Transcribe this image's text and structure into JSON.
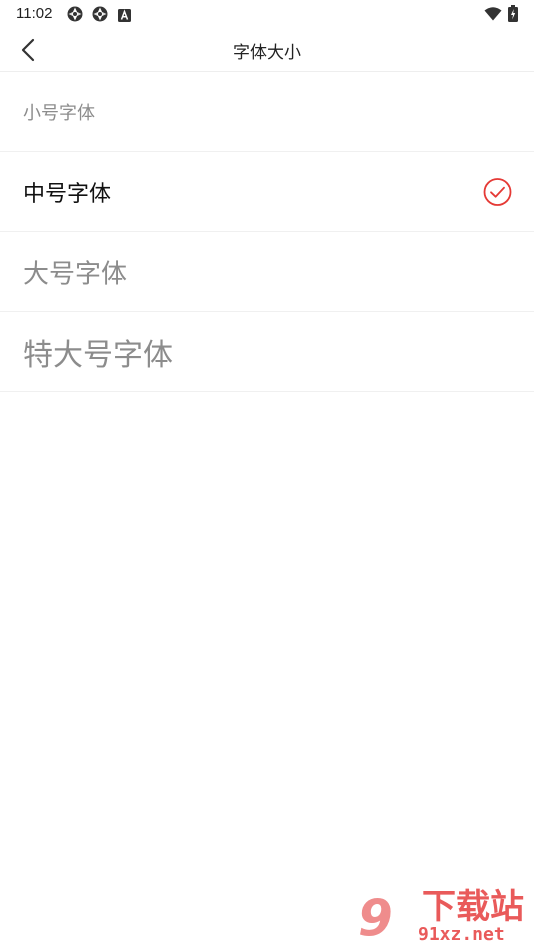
{
  "status_bar": {
    "time": "11:02",
    "icons": [
      "aperture-icon",
      "aperture-icon",
      "font-a-icon",
      "wifi-icon",
      "battery-charging-icon"
    ]
  },
  "app_bar": {
    "title": "字体大小",
    "back_icon": "chevron-left-icon"
  },
  "options": [
    {
      "label": "小号字体",
      "selected": false
    },
    {
      "label": "中号字体",
      "selected": true
    },
    {
      "label": "大号字体",
      "selected": false
    },
    {
      "label": "特大号字体",
      "selected": false
    }
  ],
  "check_icon": "circle-check-icon",
  "watermark": {
    "number": "9",
    "title": "下载站",
    "url": "91xz.net"
  },
  "colors": {
    "accent": "#e53935",
    "selected_text": "#111111",
    "unselected_text": "#8c8c8c"
  }
}
